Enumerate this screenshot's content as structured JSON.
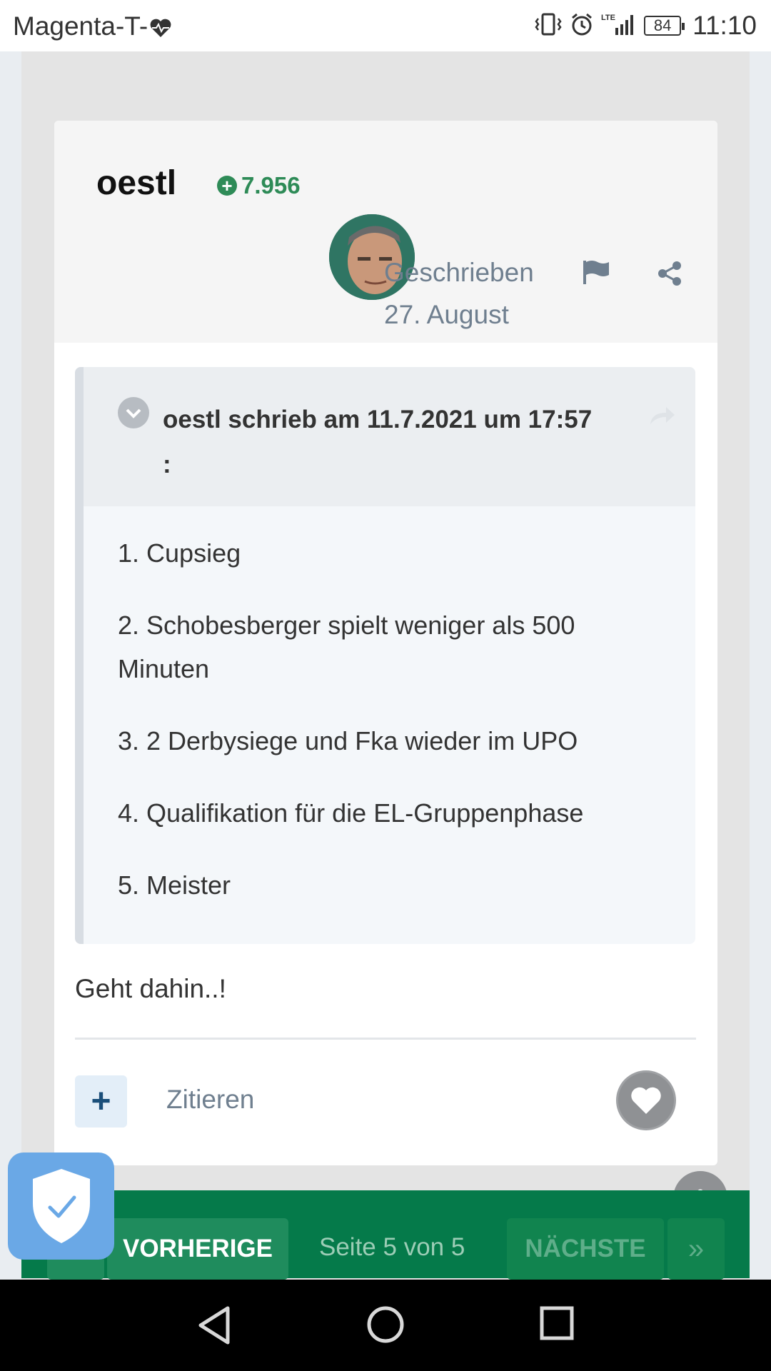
{
  "status_bar": {
    "carrier": "Magenta-T-",
    "battery": "84",
    "time": "11:10",
    "network": "LTE"
  },
  "post": {
    "author": "oestl",
    "reputation": "7.956",
    "written_label": "Geschrieben",
    "date": "27. August",
    "quote": {
      "title": "oestl schrieb am 11.7.2021 um 17:57",
      "colon": ":",
      "items": [
        "1. Cupsieg",
        "2. Schobesberger spielt weniger als 500 Minuten",
        "3. 2 Derbysiege und Fka wieder im UPO",
        "4. Qualifikation für die EL-Gruppenphase",
        "5. Meister"
      ]
    },
    "body": "Geht dahin..!",
    "quote_action": "Zitieren",
    "plus_label": "+"
  },
  "pagination": {
    "prev": "VORHERIGE",
    "info": "Seite 5 von 5",
    "next": "NÄCHSTE",
    "last": "»"
  },
  "colors": {
    "accent_green": "#057a4a",
    "reputation_green": "#2e8b57",
    "meta_gray": "#6f7f8f"
  }
}
